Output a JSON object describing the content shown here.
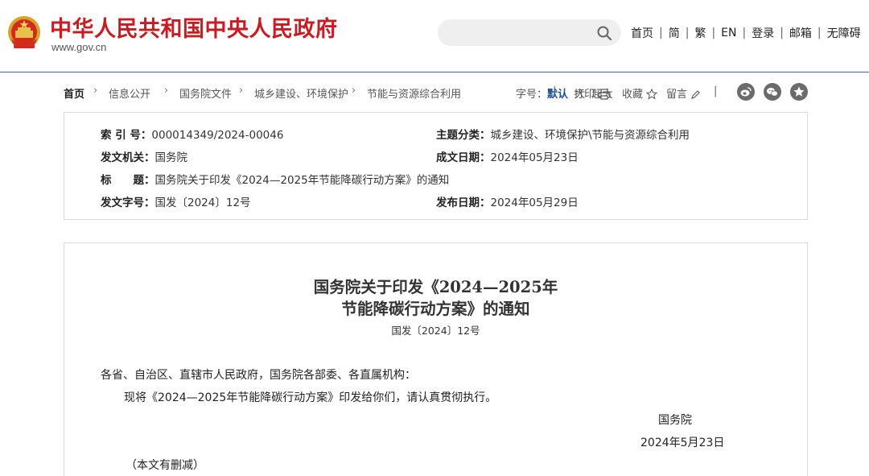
{
  "header": {
    "site_title": "中华人民共和国中央人民政府",
    "site_domain": "www.gov.cn",
    "search": {
      "placeholder": ""
    },
    "nav": [
      "首页",
      "简",
      "繁",
      "EN",
      "登录",
      "邮箱",
      "无障碍"
    ],
    "nav_separator": "|"
  },
  "breadcrumb": {
    "items": [
      "首页",
      "信息公开",
      "国务院文件",
      "城乡建设、环境保护",
      "节能与资源综合利用"
    ],
    "separator": "›"
  },
  "font_size": {
    "label": "字号：",
    "options": [
      "默认",
      "大",
      "超大"
    ],
    "selected": "默认"
  },
  "tools": {
    "print": "打印",
    "favorite": "收藏",
    "comment": "留言",
    "separator": "|"
  },
  "social": [
    "weibo-icon",
    "wechat-icon",
    "star-icon"
  ],
  "info": {
    "index_label": "索 引 号：",
    "index_value": "000014349/2024-00046",
    "topic_label": "主题分类：",
    "topic_value": "城乡建设、环境保护\\节能与资源综合利用",
    "issuer_label": "发文机关：",
    "issuer_value": "国务院",
    "written_label": "成文日期：",
    "written_value": "2024年05月23日",
    "title_label": "标　　题：",
    "title_value": "国务院关于印发《2024—2025年节能降碳行动方案》的通知",
    "docno_label": "发文字号：",
    "docno_value": "国发〔2024〕12号",
    "published_label": "发布日期：",
    "published_value": "2024年05月29日"
  },
  "article": {
    "title_line1": "国务院关于印发《2024—2025年",
    "title_line2": "节能降碳行动方案》的通知",
    "doc_number": "国发〔2024〕12号",
    "salutation": "各省、自治区、直辖市人民政府，国务院各部委、各直属机构：",
    "body": "现将《2024—2025年节能降碳行动方案》印发给你们，请认真贯彻执行。",
    "signature": "国务院",
    "date": "2024年5月23日",
    "note": "（本文有删减）"
  },
  "colors": {
    "brand_red": "#c81c22",
    "link_blue": "#1f4f9a",
    "header_rule": "#3d68a8"
  }
}
